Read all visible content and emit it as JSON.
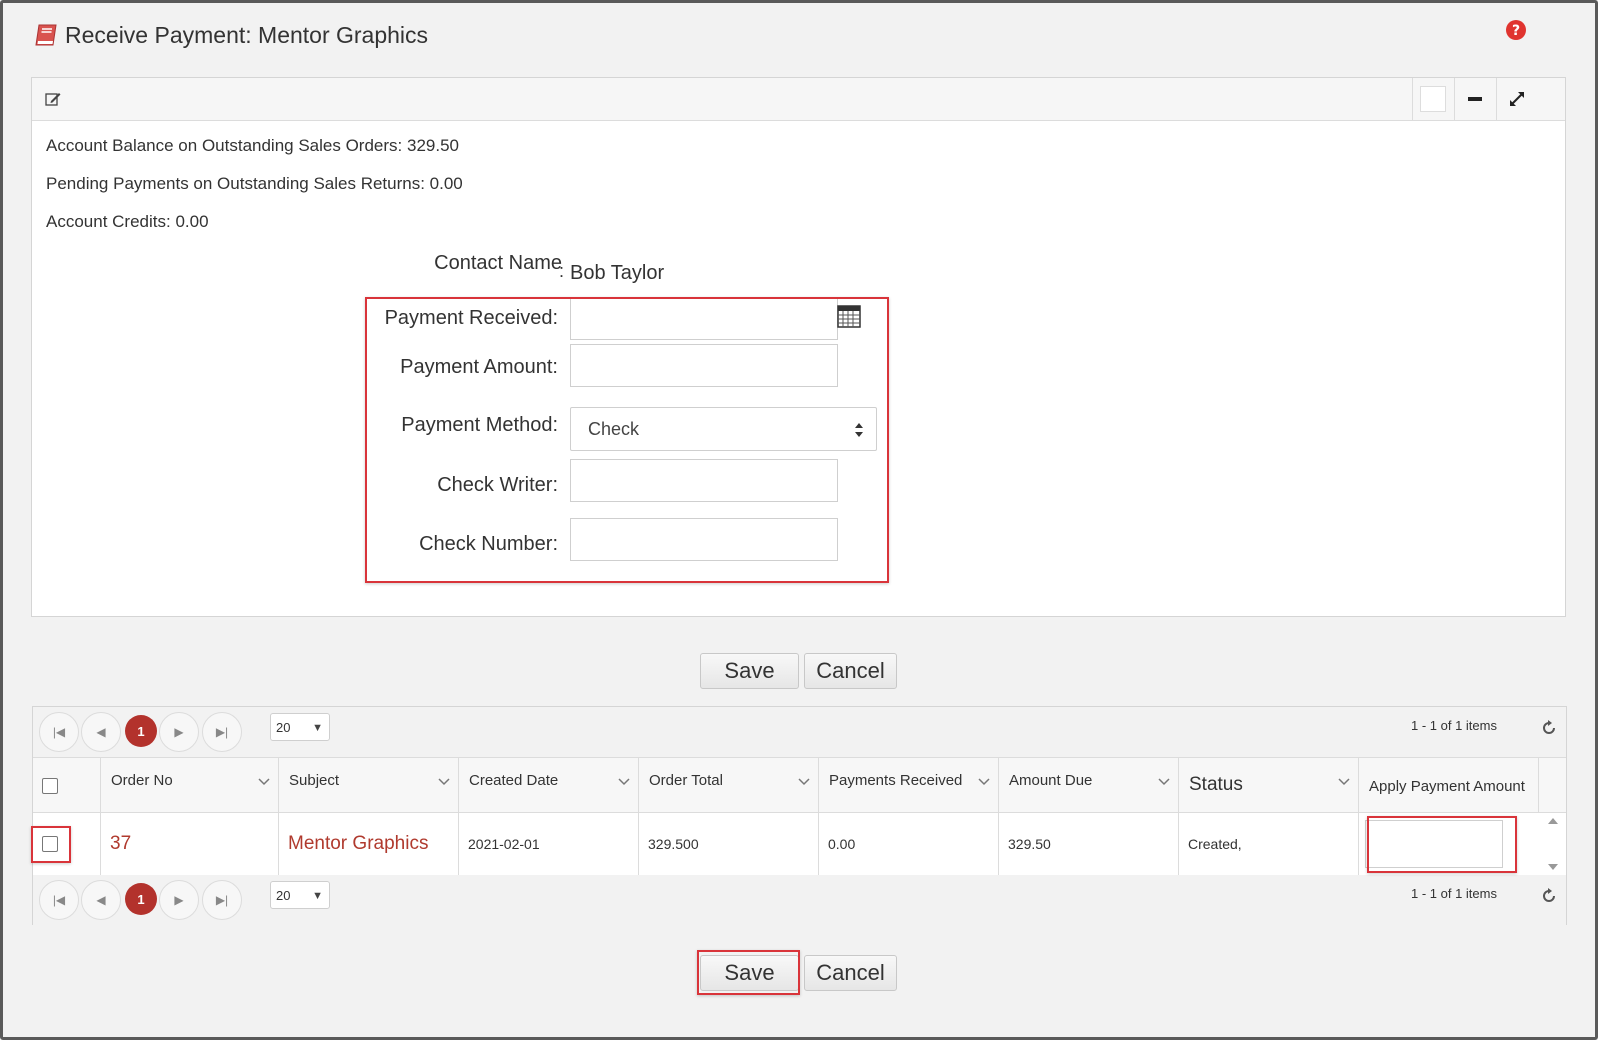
{
  "header": {
    "title": "Receive Payment: Mentor Graphics",
    "accent": "#d9343a"
  },
  "info": {
    "balance": "Account Balance on Outstanding Sales Orders: 329.50",
    "pending": "Pending Payments on Outstanding Sales Returns: 0.00",
    "credits": "Account Credits: 0.00"
  },
  "form": {
    "contact_label": "Contact Name",
    "contact_sep": ":",
    "contact_value": "Bob Taylor",
    "payment_received_label": "Payment Received:",
    "payment_received_value": "",
    "payment_amount_label": "Payment Amount:",
    "payment_amount_value": "",
    "payment_method_label": "Payment Method:",
    "payment_method_value": "Check",
    "check_writer_label": "Check Writer:",
    "check_writer_value": "",
    "check_number_label": "Check Number:",
    "check_number_value": ""
  },
  "actions": {
    "save": "Save",
    "cancel": "Cancel"
  },
  "pager": {
    "current_page": "1",
    "page_size": "20",
    "info": "1 - 1 of 1 items"
  },
  "table": {
    "columns": [
      "Order No",
      "Subject",
      "Created Date",
      "Order Total",
      "Payments Received",
      "Amount Due",
      "Status",
      "Apply Payment Amount"
    ],
    "rows": [
      {
        "order_no": "37",
        "subject": "Mentor Graphics",
        "created_date": "2021-02-01",
        "order_total": "329.500",
        "payments_received": "0.00",
        "amount_due": "329.50",
        "status": "Created,",
        "apply_amount": ""
      }
    ]
  }
}
